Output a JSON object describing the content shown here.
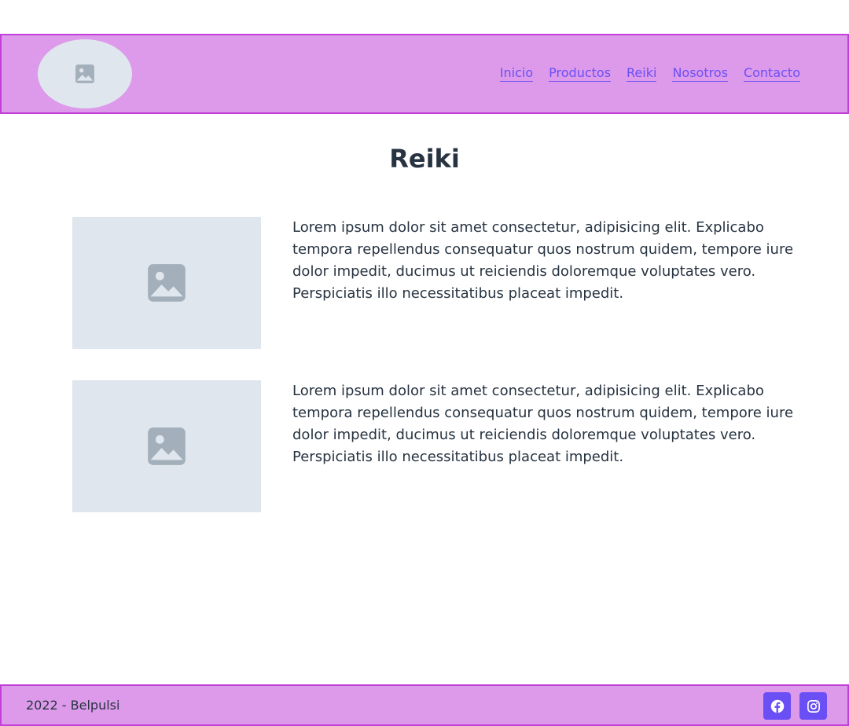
{
  "header": {
    "logo_icon": "image-placeholder-icon",
    "nav": [
      {
        "label": "Inicio"
      },
      {
        "label": "Productos"
      },
      {
        "label": "Reiki"
      },
      {
        "label": "Nosotros"
      },
      {
        "label": "Contacto"
      }
    ]
  },
  "main": {
    "title": "Reiki",
    "items": [
      {
        "image_icon": "image-placeholder-icon",
        "text": "Lorem ipsum dolor sit amet consectetur, adipisicing elit. Explicabo tempora repellendus consequatur quos nostrum quidem, tempore iure dolor impedit, ducimus ut reiciendis doloremque voluptates vero. Perspiciatis illo necessitatibus placeat impedit."
      },
      {
        "image_icon": "image-placeholder-icon",
        "text": "Lorem ipsum dolor sit amet consectetur, adipisicing elit. Explicabo tempora repellendus consequatur quos nostrum quidem, tempore iure dolor impedit, ducimus ut reiciendis doloremque voluptates vero. Perspiciatis illo necessitatibus placeat impedit."
      }
    ]
  },
  "footer": {
    "copyright": "2022 - Belpulsi",
    "social": [
      {
        "icon": "facebook-icon"
      },
      {
        "icon": "instagram-icon"
      }
    ]
  },
  "colors": {
    "header_bg": "#dd9aea",
    "header_border": "#c23fd8",
    "link": "#6a4ff5",
    "text": "#273341",
    "placeholder_bg": "#e0e6ee",
    "placeholder_icon": "#a3afba"
  }
}
